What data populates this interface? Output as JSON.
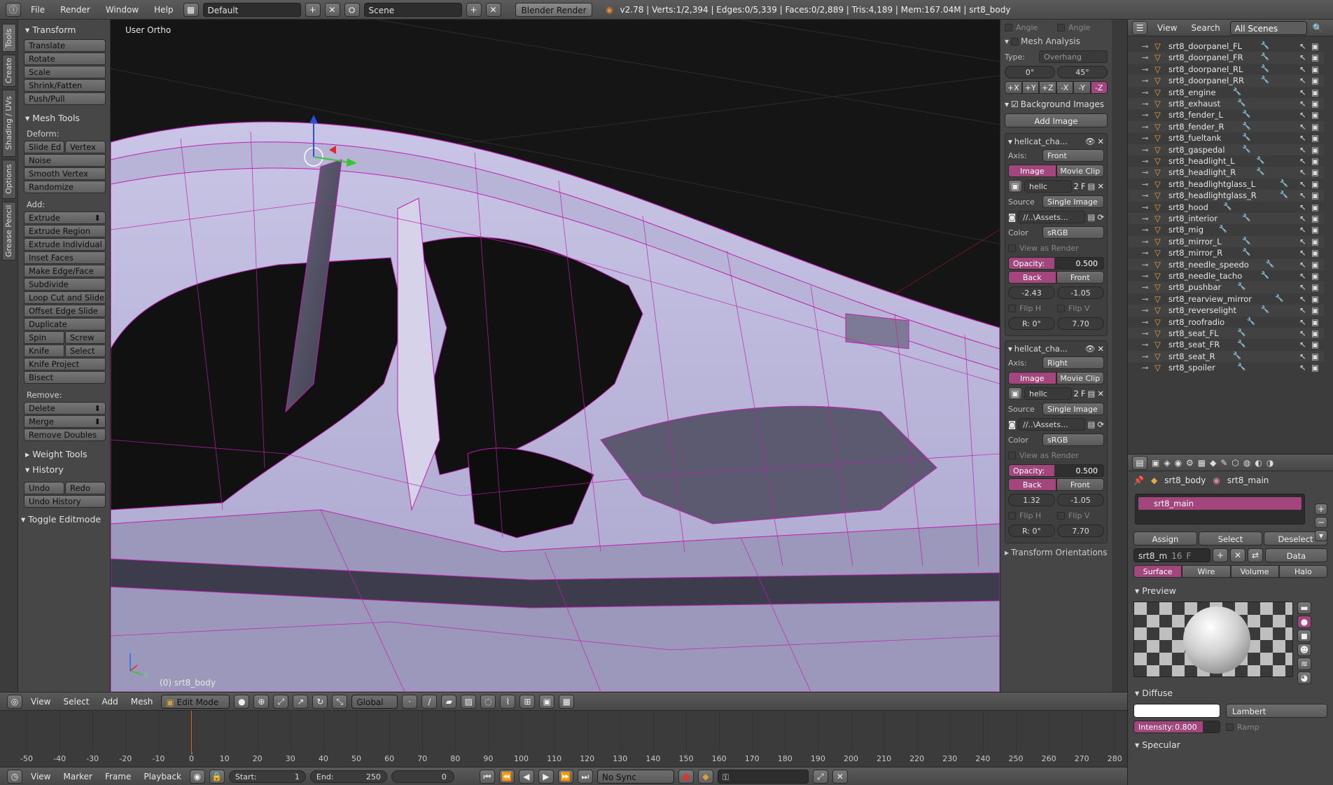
{
  "topbar": {
    "menus": [
      "File",
      "Render",
      "Window",
      "Help"
    ],
    "layout": "Default",
    "scene": "Scene",
    "engine": "Blender Render",
    "stats": "v2.78 | Verts:1/2,394 | Edges:0/5,339 | Faces:0/2,889 | Tris:4,189 | Mem:167.04M | srt8_body"
  },
  "tabs": [
    "Tools",
    "Create",
    "Shading / UVs",
    "Options",
    "Grease Pencil"
  ],
  "toolshelf": {
    "transform_title": "Transform",
    "transform": [
      "Translate",
      "Rotate",
      "Scale",
      "Shrink/Fatten",
      "Push/Pull"
    ],
    "meshtools_title": "Mesh Tools",
    "deform_label": "Deform:",
    "slide_ed": "Slide Ed",
    "vertex": "Vertex",
    "deform": [
      "Noise",
      "Smooth Vertex",
      "Randomize"
    ],
    "add_label": "Add:",
    "extrude": "Extrude",
    "add": [
      "Extrude Region",
      "Extrude Individual",
      "Inset Faces",
      "Make Edge/Face",
      "Subdivide",
      "Loop Cut and Slide",
      "Offset Edge Slide",
      "Duplicate"
    ],
    "spin": "Spin",
    "screw": "Screw",
    "knife": "Knife",
    "select": "Select",
    "knife_project": "Knife Project",
    "bisect": "Bisect",
    "remove_label": "Remove:",
    "delete": "Delete",
    "merge": "Merge",
    "remove_doubles": "Remove Doubles",
    "weight_tools": "Weight Tools",
    "history": "History",
    "undo": "Undo",
    "redo": "Redo",
    "undo_history": "Undo History",
    "toggle_editmode": "Toggle Editmode"
  },
  "viewport": {
    "view_name": "User Ortho",
    "object_label": "(0) srt8_body",
    "axis_z": "z",
    "axis_y": "y"
  },
  "npanel": {
    "angle1": "Angle",
    "angle2": "Angle",
    "mesh_analysis": "Mesh Analysis",
    "type_label": "Type:",
    "type_value": "Overhang",
    "angle_min": "0°",
    "angle_max": "45°",
    "axes": [
      "+X",
      "+Y",
      "+Z",
      "-X",
      "-Y",
      "-Z"
    ],
    "bg_images": "Background Images",
    "add_image": "Add Image",
    "images": [
      {
        "name": "hellcat_cha...",
        "axis": "Front",
        "file": "hellc",
        "users": "2",
        "fake": "F",
        "source": "Single Image",
        "path": "//..\\Assets...",
        "color": "sRGB",
        "view_as_render": "View as Render",
        "opacity_label": "Opacity:",
        "opacity": "0.500",
        "back": "Back",
        "front": "Front",
        "x": "-2.43",
        "y": "-1.05",
        "flip_h": "Flip H",
        "flip_v": "Flip V",
        "rot": "R: 0°",
        "size": "7.70"
      },
      {
        "name": "hellcat_cha...",
        "axis": "Right",
        "file": "hellc",
        "users": "2",
        "fake": "F",
        "source": "Single Image",
        "path": "//..\\Assets...",
        "color": "sRGB",
        "view_as_render": "View as Render",
        "opacity_label": "Opacity:",
        "opacity": "0.500",
        "back": "Back",
        "front": "Front",
        "x": "1.32",
        "y": "-1.05",
        "flip_h": "Flip H",
        "flip_v": "Flip V",
        "rot": "R: 0°",
        "size": "7.70"
      }
    ],
    "axis_label": "Axis:",
    "image_tab": "Image",
    "movie_clip_tab": "Movie Clip",
    "source_label": "Source",
    "color_label": "Color",
    "transform_orientations": "Transform Orientations"
  },
  "outliner": {
    "view": "View",
    "search": "Search",
    "scenes": "All Scenes",
    "items": [
      "srt8_doorpanel_FL",
      "srt8_doorpanel_FR",
      "srt8_doorpanel_RL",
      "srt8_doorpanel_RR",
      "srt8_engine",
      "srt8_exhaust",
      "srt8_fender_L",
      "srt8_fender_R",
      "srt8_fueltank",
      "srt8_gaspedal",
      "srt8_headlight_L",
      "srt8_headlight_R",
      "srt8_headlightglass_L",
      "srt8_headlightglass_R",
      "srt8_hood",
      "srt8_interior",
      "srt8_mig",
      "srt8_mirror_L",
      "srt8_mirror_R",
      "srt8_needle_speedo",
      "srt8_needle_tacho",
      "srt8_pushbar",
      "srt8_rearview_mirror",
      "srt8_reverselight",
      "srt8_roofradio",
      "srt8_seat_FL",
      "srt8_seat_FR",
      "srt8_seat_R",
      "srt8_spoiler"
    ]
  },
  "props": {
    "object": "srt8_body",
    "material": "srt8_main",
    "slot": "srt8_main",
    "assign": "Assign",
    "select": "Select",
    "deselect": "Deselect",
    "mat_field": "srt8_m",
    "mat_users": "16",
    "mat_fake": "F",
    "link": "Data",
    "tabs": [
      "Surface",
      "Wire",
      "Volume",
      "Halo"
    ],
    "preview": "Preview",
    "diffuse": "Diffuse",
    "shader": "Lambert",
    "intensity_label": "Intensity:",
    "intensity": "0.800",
    "intensity_fraction": 0.8,
    "ramp": "Ramp",
    "specular": "Specular"
  },
  "vpheader": {
    "menus": [
      "View",
      "Select",
      "Add",
      "Mesh"
    ],
    "mode": "Edit Mode",
    "orientation": "Global"
  },
  "timeline": {
    "ticks": [
      "-50",
      "-40",
      "-30",
      "-20",
      "-10",
      "0",
      "10",
      "20",
      "30",
      "40",
      "50",
      "60",
      "70",
      "80",
      "90",
      "100",
      "110",
      "120",
      "130",
      "140",
      "150",
      "160",
      "170",
      "180",
      "190",
      "200",
      "210",
      "220",
      "230",
      "240",
      "250",
      "260",
      "270",
      "280"
    ],
    "current_frame": 0
  },
  "tlheader": {
    "menus": [
      "View",
      "Marker",
      "Frame",
      "Playback"
    ],
    "start_label": "Start:",
    "start": "1",
    "end_label": "End:",
    "end": "250",
    "frame": "0",
    "sync": "No Sync"
  },
  "colors": {
    "accent": "#a2467d",
    "mesh_wire": "#c11eb0",
    "playhead": "#e06a1a"
  }
}
